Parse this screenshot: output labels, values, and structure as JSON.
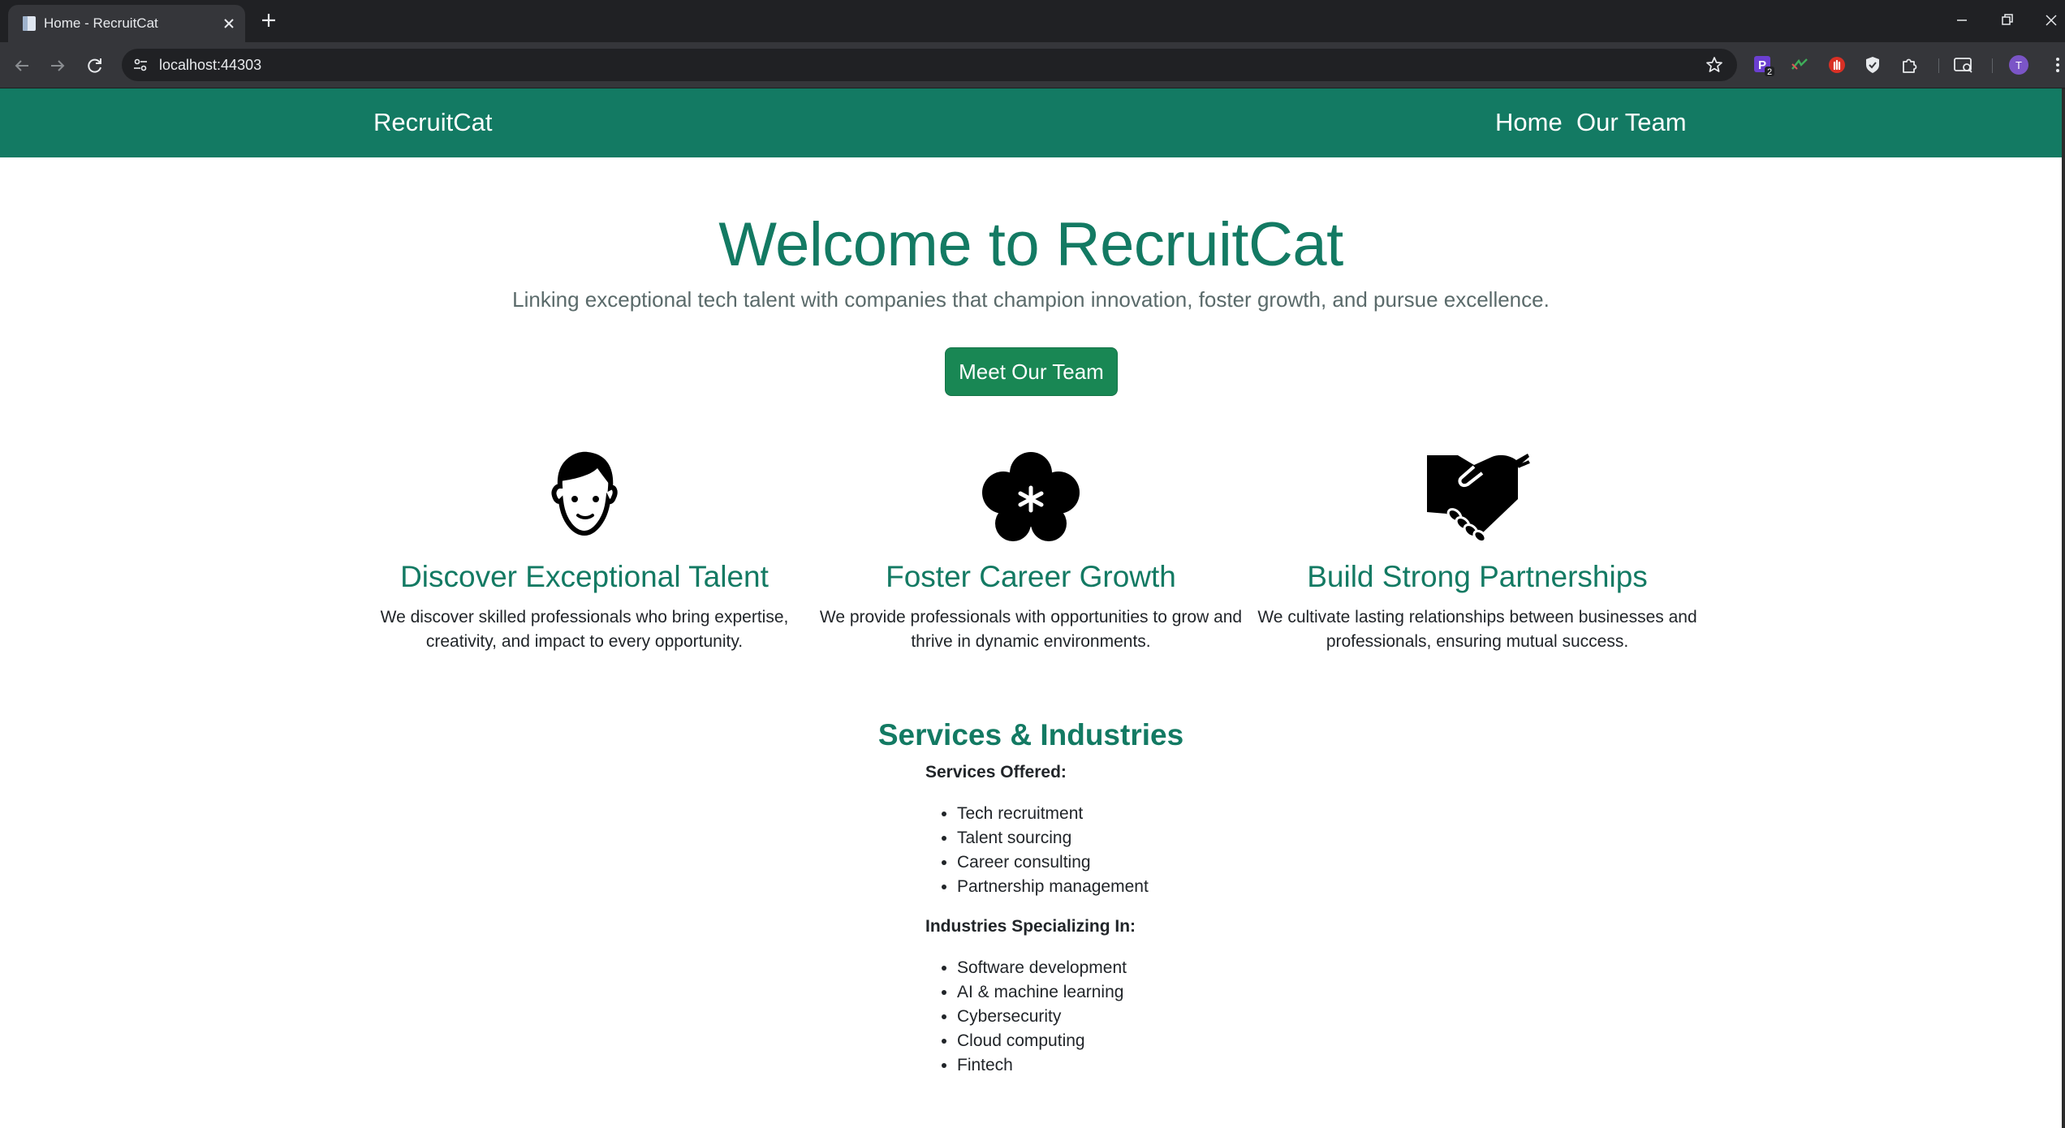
{
  "browser": {
    "tab_title": "Home - RecruitCat",
    "url": "localhost:44303",
    "extension_badge": "2",
    "profile_initial": "T"
  },
  "nav": {
    "brand": "RecruitCat",
    "links": [
      "Home",
      "Our Team"
    ]
  },
  "hero": {
    "title": "Welcome to RecruitCat",
    "subtitle": "Linking exceptional tech talent with companies that champion innovation, foster growth, and pursue excellence.",
    "cta_label": "Meet Our Team"
  },
  "features": [
    {
      "icon": "person-face-icon",
      "title": "Discover Exceptional Talent",
      "text_lines": [
        "We discover skilled professionals who bring expertise,",
        "creativity, and impact to every opportunity."
      ]
    },
    {
      "icon": "flower-icon",
      "title": "Foster Career Growth",
      "text_lines": [
        "We provide professionals with opportunities to grow and",
        "thrive in dynamic environments."
      ]
    },
    {
      "icon": "handshake-icon",
      "title": "Build Strong Partnerships",
      "text_lines": [
        "We cultivate lasting relationships between businesses and",
        "professionals, ensuring mutual success."
      ]
    }
  ],
  "services": {
    "title": "Services & Industries",
    "offered_heading": "Services Offered:",
    "offered": [
      "Tech recruitment",
      "Talent sourcing",
      "Career consulting",
      "Partnership management"
    ],
    "industries_heading": "Industries Specializing In:",
    "industries": [
      "Software development",
      "AI & machine learning",
      "Cybersecurity",
      "Cloud computing",
      "Fintech"
    ]
  },
  "colors": {
    "brand": "#137a63",
    "button": "#198754",
    "chrome_dark": "#202124",
    "chrome_toolbar": "#35363a"
  }
}
